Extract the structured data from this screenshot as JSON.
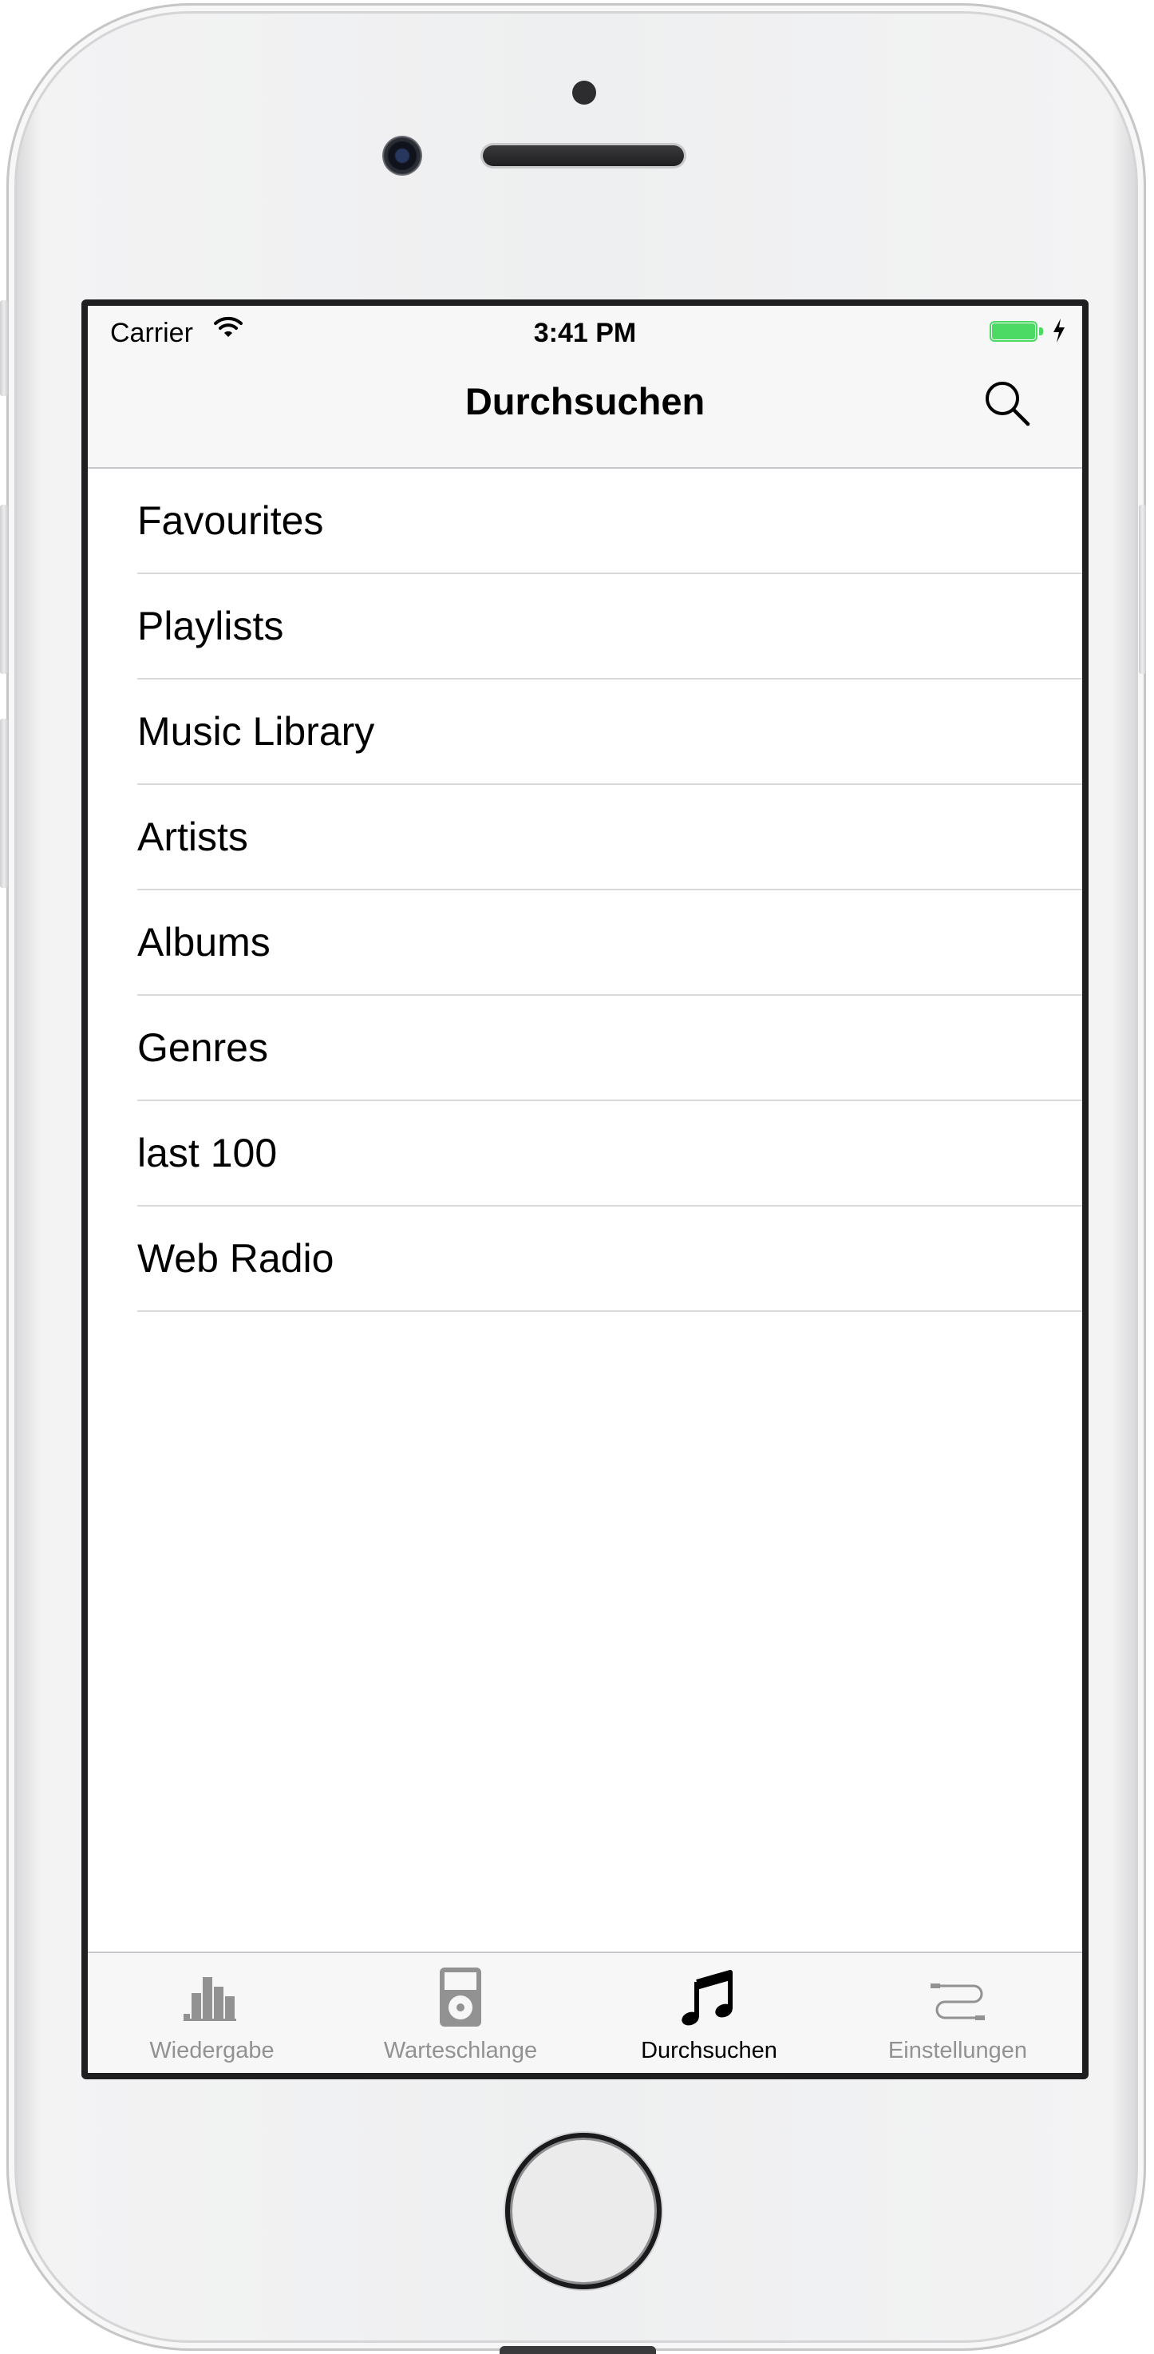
{
  "status_bar": {
    "carrier": "Carrier",
    "time": "3:41 PM",
    "battery_color": "#4cd964"
  },
  "nav_bar": {
    "title": "Durchsuchen",
    "search_icon": "search-icon"
  },
  "list": {
    "items": [
      {
        "label": "Favourites"
      },
      {
        "label": "Playlists"
      },
      {
        "label": "Music Library"
      },
      {
        "label": "Artists"
      },
      {
        "label": "Albums"
      },
      {
        "label": "Genres"
      },
      {
        "label": "last 100"
      },
      {
        "label": "Web Radio"
      }
    ],
    "chevron_icon": "chevron-right-icon"
  },
  "tab_bar": {
    "active_index": 2,
    "active_color": "#000000",
    "inactive_color": "#929292",
    "tabs": [
      {
        "label": "Wiedergabe",
        "icon": "bar-chart-icon"
      },
      {
        "label": "Warteschlange",
        "icon": "ipod-icon"
      },
      {
        "label": "Durchsuchen",
        "icon": "music-note-icon"
      },
      {
        "label": "Einstellungen",
        "icon": "cable-icon"
      }
    ]
  }
}
